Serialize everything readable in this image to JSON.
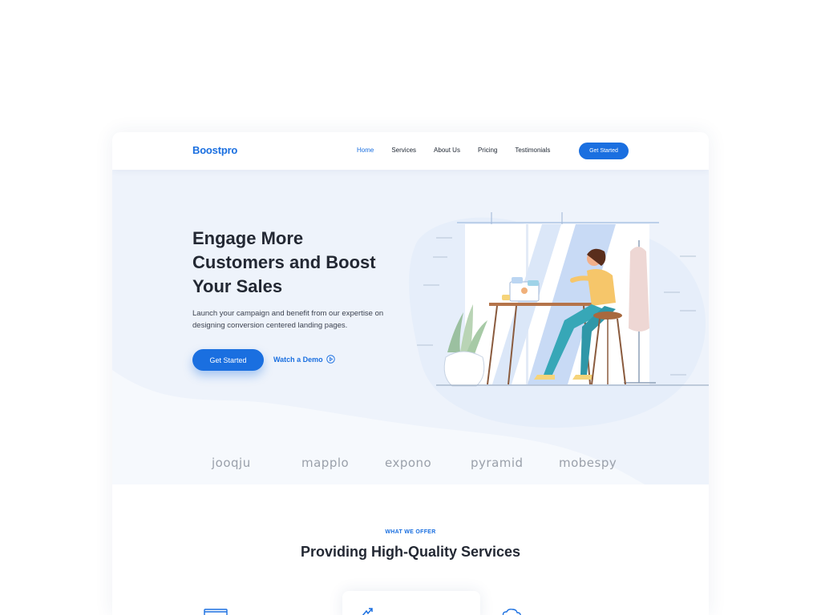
{
  "header": {
    "logo": "Boostpro",
    "nav": [
      "Home",
      "Services",
      "About Us",
      "Pricing",
      "Testimonials"
    ],
    "active_nav": "Home",
    "cta_label": "Get Started"
  },
  "hero": {
    "title_lines": [
      "Engage More",
      "Customers and Boost",
      "Your Sales"
    ],
    "subtitle_lines": [
      "Launch your campaign and benefit from our expertise on",
      "designing conversion centered landing pages."
    ],
    "primary_button": "Get Started",
    "secondary_link": "Watch a Demo",
    "secondary_icon": "play-circle-icon"
  },
  "clients": [
    "jooqju",
    "mapplo",
    "expono",
    "pyramid",
    "mobespy"
  ],
  "services": {
    "eyebrow": "WHAT WE OFFER",
    "title": "Providing High-Quality Services",
    "icons": [
      "browser-icon",
      "growth-icon",
      "cloud-icon"
    ]
  },
  "colors": {
    "primary": "#1a6fe0",
    "text_dark": "#232833",
    "background": "#f6f9fd",
    "logo_gray": "#9aa0aa"
  }
}
